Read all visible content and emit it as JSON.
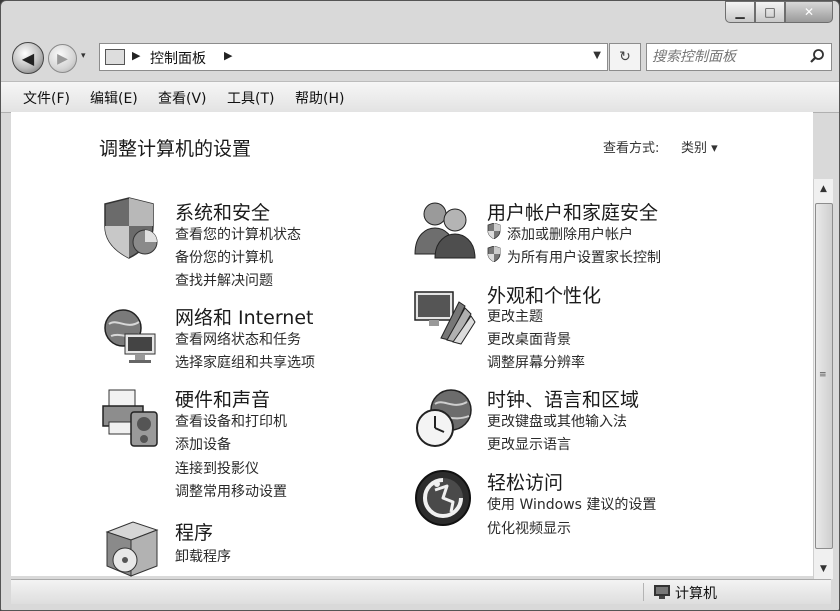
{
  "window": {
    "minimize_glyph": "▁",
    "maximize_glyph": "□",
    "close_glyph": "✕"
  },
  "nav": {
    "back_glyph": "◀",
    "forward_glyph": "▶",
    "history_glyph": "▾"
  },
  "address": {
    "separator": "▶",
    "crumb": "控制面板",
    "dropdown_glyph": "▼",
    "refresh_glyph": "↻"
  },
  "search": {
    "placeholder": "搜索控制面板"
  },
  "menu": [
    {
      "label": "文件(F)"
    },
    {
      "label": "编辑(E)"
    },
    {
      "label": "查看(V)"
    },
    {
      "label": "工具(T)"
    },
    {
      "label": "帮助(H)"
    }
  ],
  "page": {
    "title": "调整计算机的设置",
    "view_by_label": "查看方式:",
    "view_by_value": "类别 ▾"
  },
  "categories": {
    "system": {
      "title": "系统和安全",
      "links": [
        "查看您的计算机状态",
        "备份您的计算机",
        "查找并解决问题"
      ]
    },
    "network": {
      "title": "网络和 Internet",
      "links": [
        "查看网络状态和任务",
        "选择家庭组和共享选项"
      ]
    },
    "hardware": {
      "title": "硬件和声音",
      "links": [
        "查看设备和打印机",
        "添加设备",
        "连接到投影仪",
        "调整常用移动设置"
      ]
    },
    "programs": {
      "title": "程序",
      "links": [
        "卸载程序"
      ]
    },
    "users": {
      "title": "用户帐户和家庭安全",
      "links": [
        "添加或删除用户帐户",
        "为所有用户设置家长控制"
      ]
    },
    "appearance": {
      "title": "外观和个性化",
      "links": [
        "更改主题",
        "更改桌面背景",
        "调整屏幕分辨率"
      ]
    },
    "clock": {
      "title": "时钟、语言和区域",
      "links": [
        "更改键盘或其他输入法",
        "更改显示语言"
      ]
    },
    "ease": {
      "title": "轻松访问",
      "links": [
        "使用 Windows 建议的设置",
        "优化视频显示"
      ]
    }
  },
  "scrollbar": {
    "up_glyph": "▲",
    "down_glyph": "▼",
    "grip_glyph": "≡"
  },
  "status": {
    "location": "计算机"
  }
}
